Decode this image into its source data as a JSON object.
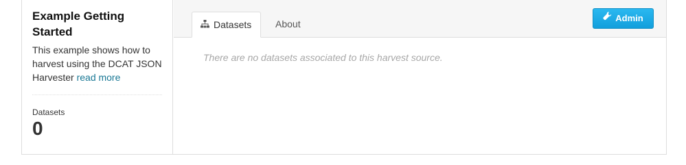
{
  "sidebar": {
    "title": "Example Getting Started",
    "description": "This example shows how to harvest using the DCAT JSON Harvester",
    "read_more": "read more",
    "stat_label": "Datasets",
    "stat_value": "0"
  },
  "tabs": [
    {
      "label": "Datasets",
      "icon": "sitemap-icon",
      "active": true
    },
    {
      "label": "About",
      "active": false
    }
  ],
  "admin_button": {
    "label": "Admin",
    "icon": "wrench-icon"
  },
  "main": {
    "empty_message": "There are no datasets associated to this harvest source."
  },
  "colors": {
    "accent": "#1cb0ec",
    "link": "#187794",
    "muted": "#a7a7a7"
  }
}
